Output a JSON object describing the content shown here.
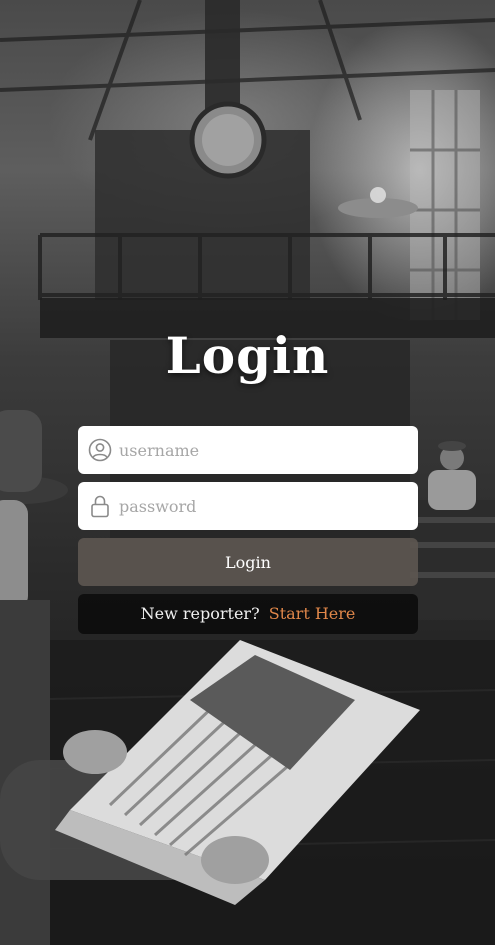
{
  "page": {
    "title": "Login"
  },
  "form": {
    "username_placeholder": "username",
    "password_placeholder": "password",
    "login_button": "Login"
  },
  "signup": {
    "prompt": "New reporter?",
    "link_label": "Start Here"
  },
  "icons": {
    "username": "user-circle-icon",
    "password": "lock-icon"
  },
  "colors": {
    "button_bg": "#5c5650",
    "signup_link": "#e0874a",
    "field_bg": "#ffffff",
    "placeholder": "#a6a6a6"
  }
}
